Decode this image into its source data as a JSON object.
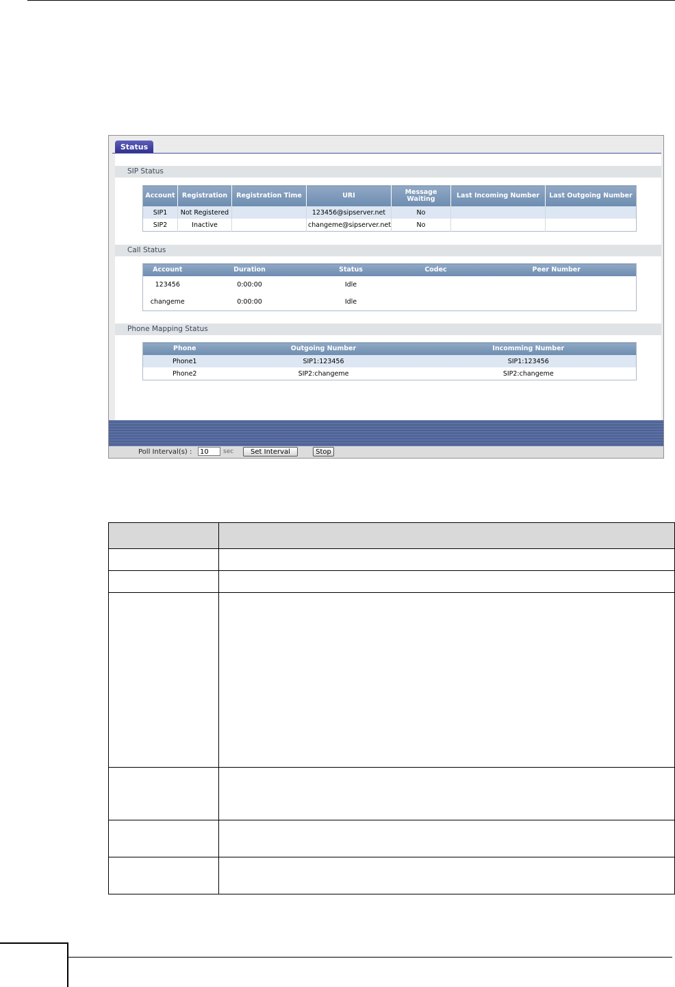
{
  "tab": {
    "label": "Status"
  },
  "sip_status": {
    "title": "SIP Status",
    "columns": [
      "Account",
      "Registration",
      "Registration Time",
      "URI",
      "Message Waiting",
      "Last Incoming Number",
      "Last Outgoing Number"
    ],
    "rows": [
      [
        "SIP1",
        "Not Registered",
        "",
        "123456@sipserver.net",
        "No",
        "",
        ""
      ],
      [
        "SIP2",
        "Inactive",
        "",
        "changeme@sipserver.net",
        "No",
        "",
        ""
      ]
    ]
  },
  "call_status": {
    "title": "Call Status",
    "columns": [
      "Account",
      "Duration",
      "Status",
      "Codec",
      "Peer Number"
    ],
    "rows": [
      [
        "123456",
        "0:00:00",
        "Idle",
        "",
        ""
      ],
      [
        "changeme",
        "0:00:00",
        "Idle",
        "",
        ""
      ]
    ]
  },
  "phone_mapping": {
    "title": "Phone Mapping Status",
    "columns": [
      "Phone",
      "Outgoing Number",
      "Incomming Number"
    ],
    "rows": [
      [
        "Phone1",
        "SIP1:123456",
        "SIP1:123456"
      ],
      [
        "Phone2",
        "SIP2:changeme",
        "SIP2:changeme"
      ]
    ]
  },
  "poll": {
    "label": "Poll Interval(s) :",
    "value": "10",
    "unit": "sec",
    "set_button": "Set Interval",
    "stop_button": "Stop"
  }
}
